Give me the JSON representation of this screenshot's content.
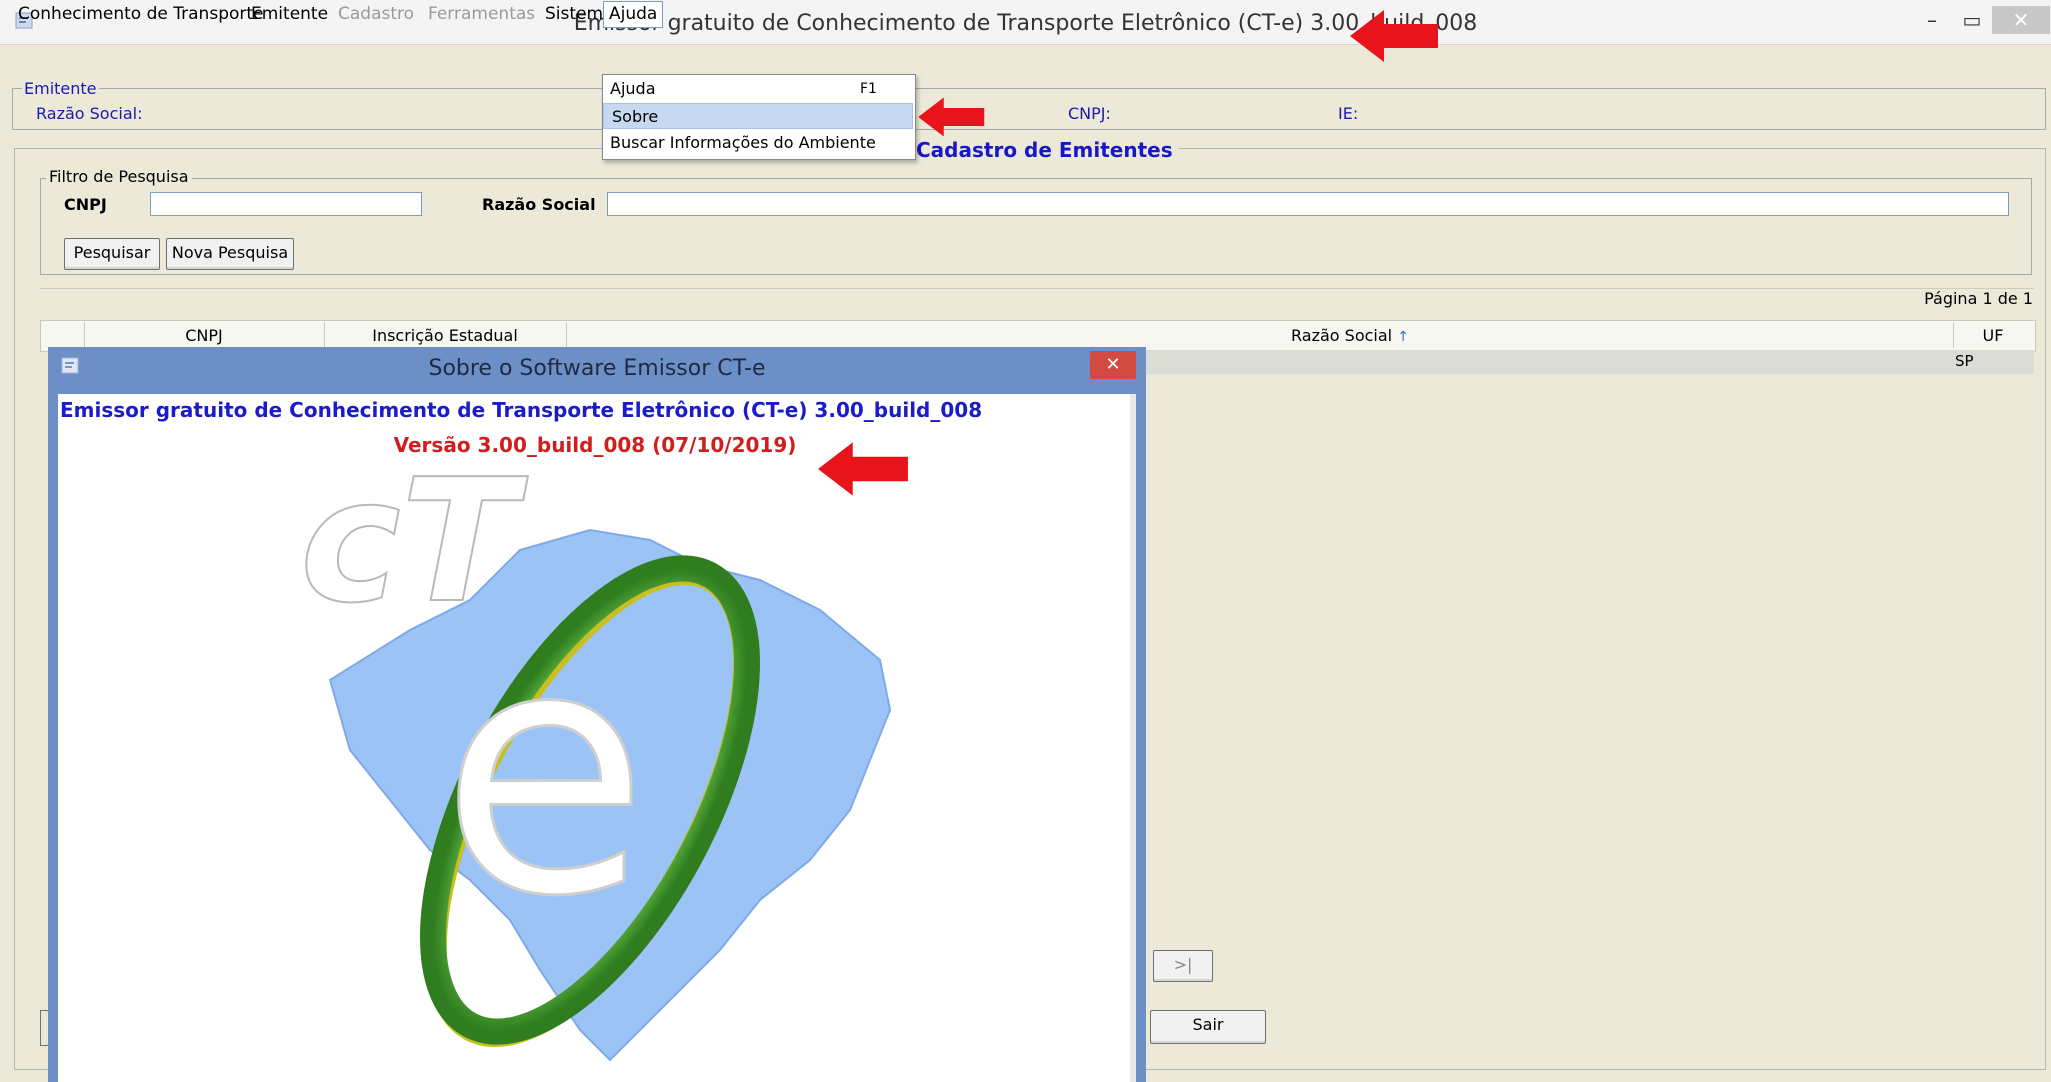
{
  "window": {
    "title": "Emissor gratuito de Conhecimento de Transporte Eletrônico (CT-e) 3.00_build_008",
    "minimize": "–",
    "maximize": "▭",
    "close": "✕"
  },
  "menubar": {
    "items": [
      {
        "label": "Conhecimento de Transporte",
        "enabled": true
      },
      {
        "label": "Emitente",
        "enabled": true
      },
      {
        "label": "Cadastro",
        "enabled": false
      },
      {
        "label": "Ferramentas",
        "enabled": false
      },
      {
        "label": "Sistema",
        "enabled": true
      },
      {
        "label": "Ajuda",
        "enabled": true,
        "open": true
      }
    ]
  },
  "dropdown": {
    "items": [
      {
        "label": "Ajuda",
        "shortcut": "F1"
      },
      {
        "label": "Sobre",
        "highlighted": true
      },
      {
        "label": "Buscar Informações do Ambiente"
      }
    ]
  },
  "emitente": {
    "legend": "Emitente",
    "razao_social_label": "Razão Social:",
    "cnpj_label": "CNPJ:",
    "ie_label": "IE:"
  },
  "cadastro": {
    "title": "Cadastro de Emitentes",
    "filter": {
      "legend": "Filtro de Pesquisa",
      "cnpj_label": "CNPJ",
      "cnpj_value": "",
      "razao_social_label": "Razão Social",
      "razao_social_value": "",
      "search_button": "Pesquisar",
      "new_search_button": "Nova Pesquisa"
    },
    "pager": {
      "text": "Página 1 de 1",
      "last_button": ">|"
    },
    "table": {
      "columns": [
        "CNPJ",
        "Inscrição Estadual",
        "Razão Social",
        "UF"
      ],
      "sort_indicator": "↑",
      "rows": [
        {
          "uf": "SP"
        }
      ]
    },
    "exit_button": "Sair"
  },
  "about_dialog": {
    "title": "Sobre o Software Emissor CT-e",
    "close": "✕",
    "heading": "Emissor gratuito de Conhecimento de Transporte Eletrônico (CT-e) 3.00_build_008",
    "version": "Versão 3.00_build_008 (07/10/2019)",
    "logo_text": "cT-e"
  },
  "colors": {
    "annotation_arrow": "#e8141b",
    "dialog_frame": "#6c90c6",
    "heading_blue": "#1b1bc9",
    "version_red": "#d21d1d",
    "logo_map": "#9cc3f5",
    "logo_ring_green": "#3f9a2c",
    "logo_ring_yellow": "#c8c020"
  }
}
